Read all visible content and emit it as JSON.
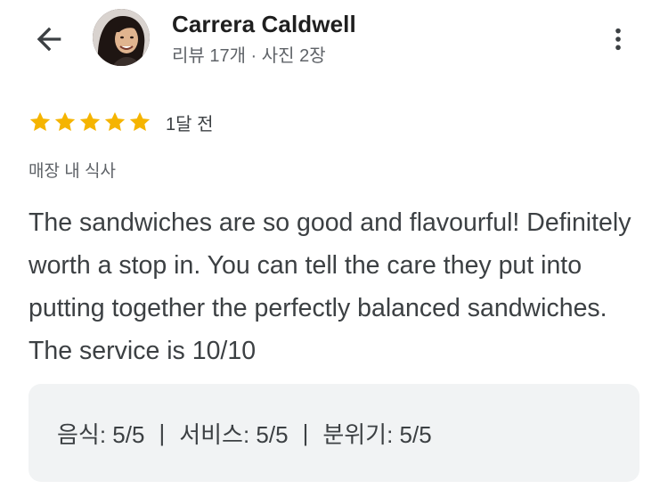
{
  "header": {
    "reviewer_name": "Carrera Caldwell",
    "reviewer_meta": "리뷰 17개 · 사진 2장",
    "back_icon": "arrow-back-icon",
    "more_icon": "more-vert-icon"
  },
  "review": {
    "rating": 5,
    "rating_max": 5,
    "time_ago": "1달 전",
    "dine_type": "매장 내 식사",
    "text": "The sandwiches are so good and flavourful! Definitely worth a stop in. You can tell the care they put into putting together the perfectly balanced sandwiches. The service is 10/10",
    "attributes": [
      {
        "text": "음식: 5/5"
      },
      {
        "text": "서비스: 5/5"
      },
      {
        "text": "분위기: 5/5"
      }
    ],
    "separator": "|"
  },
  "colors": {
    "star": "#f5b400",
    "attr_bg": "#f1f3f4",
    "text_primary": "#1f1f1f",
    "text_secondary": "#5f6368"
  }
}
